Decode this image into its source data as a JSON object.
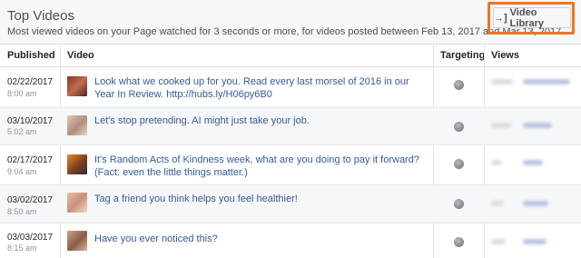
{
  "header": {
    "title": "Top Videos",
    "subtitle": "Most viewed videos on your Page watched for 3 seconds or more, for videos posted between Feb 13, 2017 and Mar 13, 2017.",
    "library_button": {
      "icon": "login-arrow-icon",
      "label": "Video Library"
    }
  },
  "columns": [
    "Published",
    "Video",
    "Targeting",
    "Views"
  ],
  "rows": [
    {
      "date": "02/22/2017",
      "time": "8:00 am",
      "video": "Look what we cooked up for you. Read every last morsel of 2016 in our Year In Review. http://hubs.ly/H06py6B0",
      "targeting_icon": "globe-icon"
    },
    {
      "date": "03/10/2017",
      "time": "5:02 am",
      "video": "Let's stop pretending. AI might just take your job.",
      "targeting_icon": "globe-icon"
    },
    {
      "date": "02/17/2017",
      "time": "9:04 am",
      "video": "It's Random Acts of Kindness week, what are you doing to pay it forward? (Fact: even the little things matter.)",
      "targeting_icon": "globe-icon"
    },
    {
      "date": "03/02/2017",
      "time": "8:50 am",
      "video": "Tag a friend you think helps you feel healthier!",
      "targeting_icon": "globe-icon"
    },
    {
      "date": "03/03/2017",
      "time": "8:15 am",
      "video": "Have you ever noticed this?",
      "targeting_icon": "globe-icon"
    }
  ],
  "colors": {
    "accent_outline": "#f4731f",
    "link": "#365899",
    "header_bg": "#f6f7f9"
  }
}
